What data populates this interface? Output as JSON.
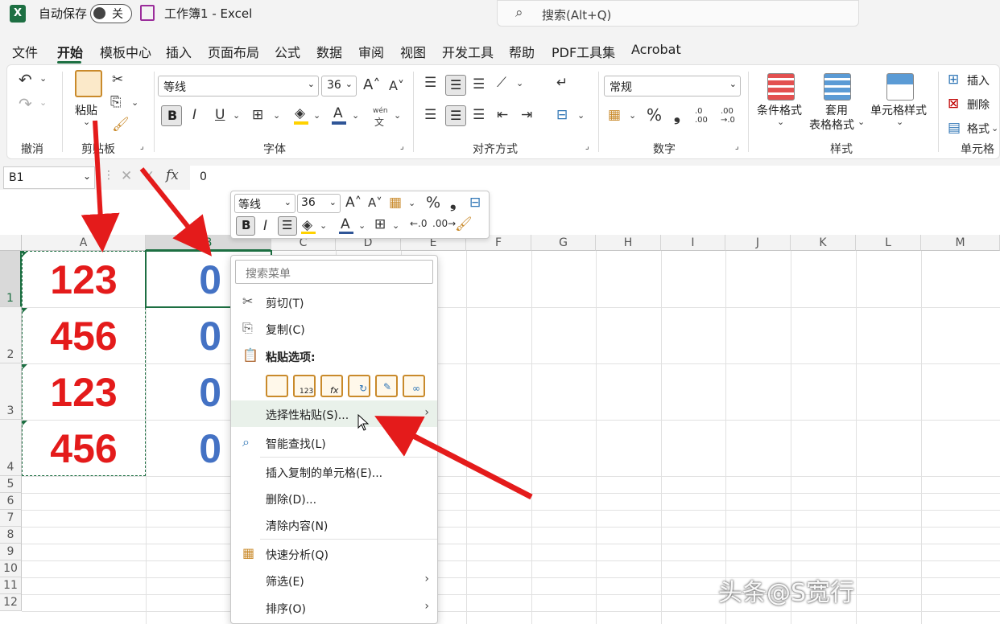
{
  "titlebar": {
    "autosave_label": "自动保存",
    "autosave_state": "关",
    "doc_title": "工作簿1",
    "sep": " - ",
    "app_name": "Excel",
    "search_placeholder": "搜索(Alt+Q)"
  },
  "menu": {
    "tabs": [
      "文件",
      "开始",
      "模板中心",
      "插入",
      "页面布局",
      "公式",
      "数据",
      "审阅",
      "视图",
      "开发工具",
      "帮助",
      "PDF工具集",
      "Acrobat"
    ],
    "active": "开始"
  },
  "ribbon": {
    "groups": {
      "undo": "撤消",
      "clipboard": "剪贴板",
      "font": "字体",
      "align": "对齐方式",
      "number": "数字",
      "styles": "样式",
      "cells": "单元格"
    },
    "paste_label": "粘贴",
    "font_name": "等线",
    "font_size": "36",
    "number_format": "常规",
    "cond_format": "条件格式",
    "table_format_1": "套用",
    "table_format_2": "表格格式",
    "cell_styles": "单元格样式",
    "insert": "插入",
    "delete": "删除",
    "format": "格式",
    "bold": "B",
    "italic": "I",
    "underline": "U",
    "percent": "%",
    "comma": "❟",
    "wen": "wén",
    "wen_sub": "文",
    "inc_decimal_1": ".0",
    "inc_decimal_2": ".00",
    "dec_decimal_1": ".00",
    "dec_decimal_2": "→.0"
  },
  "formula": {
    "name_box": "B1",
    "fx": "fx",
    "value": "0"
  },
  "sheet": {
    "columns": [
      "A",
      "B",
      "C",
      "D",
      "E",
      "F",
      "G",
      "H",
      "I",
      "J",
      "K",
      "L",
      "M"
    ],
    "rows": [
      "1",
      "2",
      "3",
      "4",
      "5",
      "6",
      "7",
      "8",
      "9",
      "10",
      "11",
      "12"
    ],
    "colA": [
      "123",
      "456",
      "123",
      "456"
    ],
    "colB": [
      "0",
      "0",
      "0",
      "0"
    ],
    "colors": {
      "red": "#e41b1b",
      "blue": "#4472c4"
    }
  },
  "minitoolbar": {
    "font_name": "等线",
    "font_size": "36",
    "bold": "B",
    "italic": "I",
    "percent": "%",
    "comma": "❟"
  },
  "context_menu": {
    "search_placeholder": "搜索菜单",
    "cut": "剪切(T)",
    "copy": "复制(C)",
    "paste_options": "粘贴选项:",
    "paste_special": "选择性粘贴(S)...",
    "smart_lookup": "智能查找(L)",
    "insert_copied": "插入复制的单元格(E)...",
    "delete": "删除(D)...",
    "clear": "清除内容(N)",
    "quick_analysis": "快速分析(Q)",
    "filter": "筛选(E)",
    "sort": "排序(O)",
    "paste_icons": [
      "paste-icon",
      "paste-values-icon",
      "paste-formulas-icon",
      "paste-transpose-icon",
      "paste-formatting-icon",
      "paste-link-icon"
    ]
  },
  "watermark": "头条@S宽行"
}
